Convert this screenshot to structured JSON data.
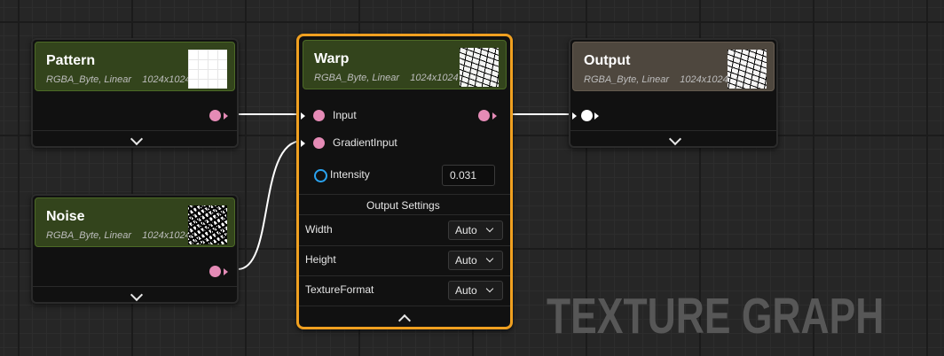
{
  "nodes": {
    "pattern": {
      "title": "Pattern",
      "format": "RGBA_Byte, Linear",
      "size": "1024x1024"
    },
    "noise": {
      "title": "Noise",
      "format": "RGBA_Byte, Linear",
      "size": "1024x1024"
    },
    "warp": {
      "title": "Warp",
      "format": "RGBA_Byte, Linear",
      "size": "1024x1024",
      "inputs": [
        "Input",
        "GradientInput"
      ],
      "intensity_label": "Intensity",
      "intensity_value": "0.031",
      "output_settings_label": "Output Settings",
      "settings": [
        {
          "label": "Width",
          "value": "Auto"
        },
        {
          "label": "Height",
          "value": "Auto"
        },
        {
          "label": "TextureFormat",
          "value": "Auto"
        }
      ]
    },
    "output": {
      "title": "Output",
      "format": "RGBA_Byte, Linear",
      "size": "1024x1024"
    }
  },
  "watermark": "TEXTURE GRAPH",
  "icons": {
    "expand": "chevron-down-icon",
    "collapse": "chevron-up-icon",
    "pin": "exec-pin-icon"
  },
  "colors": {
    "pin": "#e58bb6",
    "selected_border": "#f0a020",
    "node_header_green": "#33441c",
    "node_header_brown": "#4e473e",
    "intensity_ring": "#2aa3f0"
  }
}
